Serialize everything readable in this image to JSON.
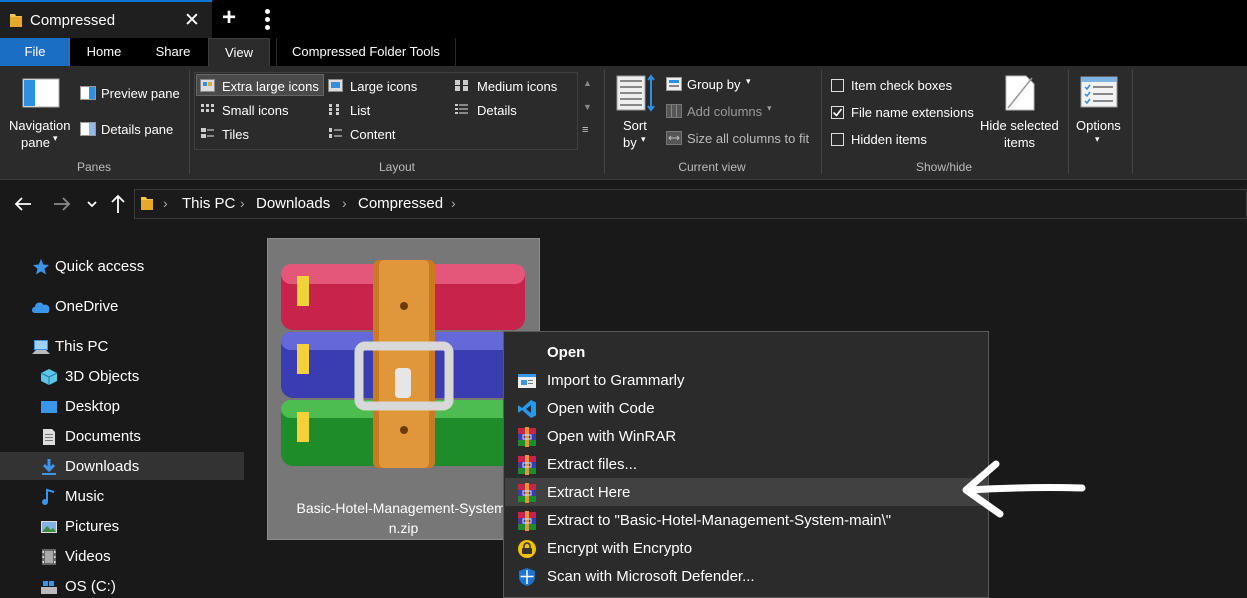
{
  "window": {
    "tab_title": "Compressed",
    "close_glyph": "✕",
    "new_tab_glyph": "+"
  },
  "ribbon_tabs": {
    "file": "File",
    "home": "Home",
    "share": "Share",
    "view": "View",
    "compressed_tools": "Compressed Folder Tools"
  },
  "ribbon": {
    "panes": {
      "navigation_pane_1": "Navigation",
      "navigation_pane_2": "pane",
      "preview_pane": "Preview pane",
      "details_pane": "Details pane",
      "group": "Panes"
    },
    "layout": {
      "extra_large_icons": "Extra large icons",
      "large_icons": "Large icons",
      "medium_icons": "Medium icons",
      "small_icons": "Small icons",
      "list": "List",
      "details": "Details",
      "tiles": "Tiles",
      "content": "Content",
      "group": "Layout"
    },
    "current_view": {
      "sort_by_1": "Sort",
      "sort_by_2": "by",
      "group_by": "Group by",
      "add_columns": "Add columns",
      "size_all_columns": "Size all columns to fit",
      "group": "Current view"
    },
    "show_hide": {
      "item_check_boxes": "Item check boxes",
      "file_name_extensions": "File name extensions",
      "hidden_items": "Hidden items",
      "hide_selected_1": "Hide selected",
      "hide_selected_2": "items",
      "group": "Show/hide",
      "item_check_boxes_checked": false,
      "file_name_extensions_checked": true,
      "hidden_items_checked": false
    },
    "options": {
      "label": "Options"
    }
  },
  "breadcrumb": [
    "This PC",
    "Downloads",
    "Compressed"
  ],
  "sidebar": {
    "quick_access": "Quick access",
    "onedrive": "OneDrive",
    "this_pc": "This PC",
    "objects_3d": "3D Objects",
    "desktop": "Desktop",
    "documents": "Documents",
    "downloads": "Downloads",
    "music": "Music",
    "pictures": "Pictures",
    "videos": "Videos",
    "os_c": "OS (C:)"
  },
  "file": {
    "name_line1": "Basic-Hotel-Management-System-",
    "name_line2": "n.zip"
  },
  "context_menu": {
    "open": "Open",
    "import_grammarly": "Import to Grammarly",
    "open_with_code": "Open with Code",
    "open_with_winrar": "Open with WinRAR",
    "extract_files": "Extract files...",
    "extract_here": "Extract Here",
    "extract_to": "Extract to \"Basic-Hotel-Management-System-main\\\"",
    "encrypt": "Encrypt with Encrypto",
    "scan_defender": "Scan with Microsoft Defender..."
  },
  "colors": {
    "accent": "#1a6fc4",
    "background": "#191919",
    "ribbon": "#2b2b2b",
    "menu_hover": "#414141"
  }
}
